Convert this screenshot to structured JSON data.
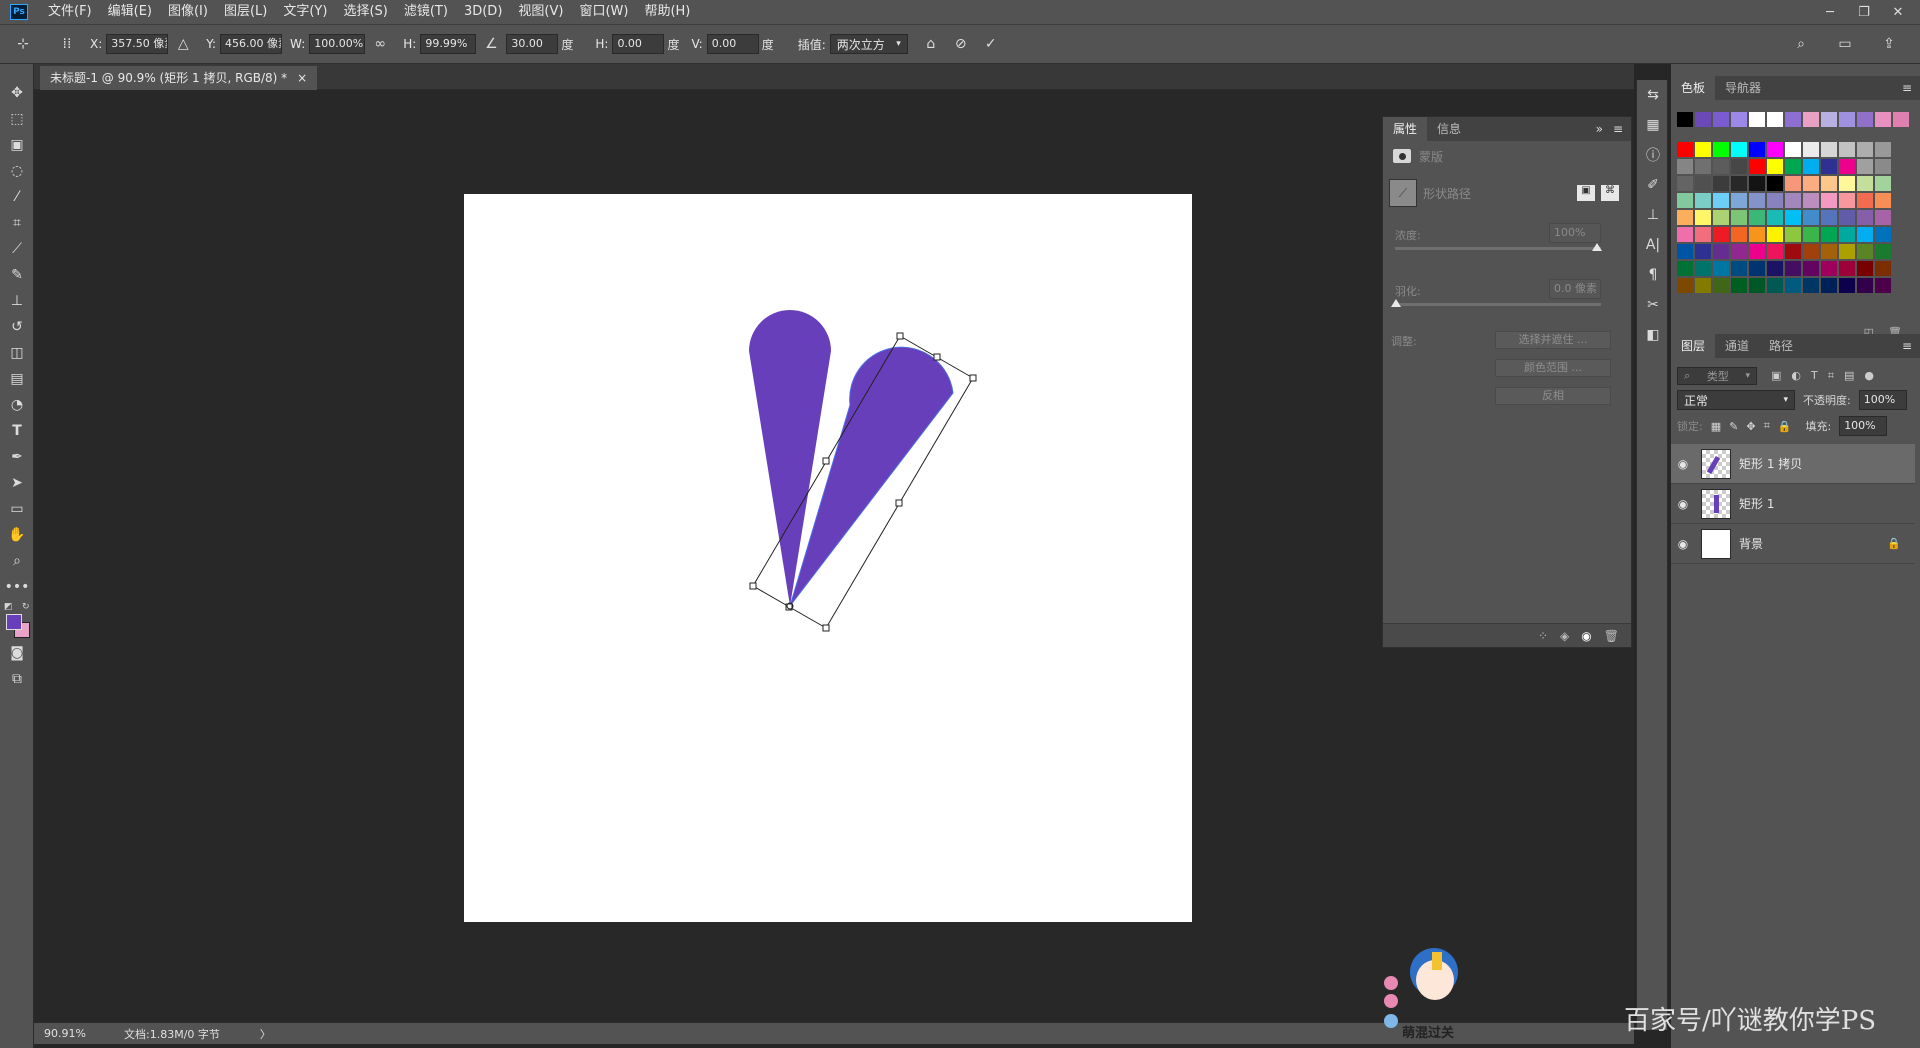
{
  "menu": {
    "logo": "Ps",
    "items": [
      "文件(F)",
      "编辑(E)",
      "图像(I)",
      "图层(L)",
      "文字(Y)",
      "选择(S)",
      "滤镜(T)",
      "3D(D)",
      "视图(V)",
      "窗口(W)",
      "帮助(H)"
    ],
    "window_buttons": [
      "─",
      "❐",
      "✕"
    ]
  },
  "options": {
    "x_label": "X:",
    "x_value": "357.50 像素",
    "y_label": "Y:",
    "y_value": "456.00 像素",
    "w_label": "W:",
    "w_value": "100.00%",
    "h_label": "H:",
    "h_value": "99.99%",
    "angle_value": "30.00",
    "angle_unit": "度",
    "hskew_label": "H:",
    "hskew_value": "0.00",
    "hskew_unit": "度",
    "vskew_label": "V:",
    "vskew_value": "0.00",
    "vskew_unit": "度",
    "interp_label": "插值:",
    "interp_value": "两次立方"
  },
  "document": {
    "tab_title": "未标题-1 @ 90.9% (矩形 1 拷贝, RGB/8) *",
    "tab_close": "×",
    "shape_color": "#673fbb"
  },
  "status": {
    "zoom": "90.91%",
    "doc_info": "文档:1.83M/0 字节",
    "arrow": "〉"
  },
  "properties": {
    "tabs": [
      "属性",
      "信息"
    ],
    "mask_label": "蒙版",
    "shape_path_label": "形状路径",
    "density_label": "浓度:",
    "density_value": "100%",
    "density_level": 1.0,
    "feather_label": "羽化:",
    "feather_value": "0.0 像素",
    "feather_level": 0.0,
    "adjust_label": "调整:",
    "buttons": [
      "选择并遮住 ...",
      "颜色范围 ...",
      "反相"
    ]
  },
  "swatches": {
    "tabs": [
      "色板",
      "导航器"
    ],
    "recent": [
      "#000000",
      "#6b4ab7",
      "#7a5bd0",
      "#9c88e6",
      "#ffffff",
      "#ffffff",
      "#8c6fd0",
      "#e8a0c4",
      "#b8b0e0",
      "#a090e0",
      "#9070c8",
      "#e890c0",
      "#e080b0"
    ],
    "grid": [
      [
        "#ff0000",
        "#ffff00",
        "#00ff00",
        "#00ffff",
        "#0000ff",
        "#ff00ff",
        "#ffffff",
        "#ebebeb",
        "#d6d6d6",
        "#c2c2c2",
        "#adadad",
        "#999999"
      ],
      [
        "#858585",
        "#707070",
        "#5c5c5c",
        "#474747",
        "#ff0000",
        "#ffff00",
        "#00a650",
        "#00aeef",
        "#2e3192",
        "#ec008c",
        "#a0a0a0",
        "#8a8a8a"
      ],
      [
        "#646464",
        "#505050",
        "#3c3c3c",
        "#282828",
        "#141414",
        "#000000",
        "#f7977a",
        "#f9ad81",
        "#fdc68a",
        "#fff79a",
        "#c4df9b",
        "#a3d39c"
      ],
      [
        "#82ca9d",
        "#7bcdc8",
        "#6ecff6",
        "#7ea7d8",
        "#8493ca",
        "#8882be",
        "#a187be",
        "#bc8dbf",
        "#f49ac2",
        "#f6989d",
        "#f26c4f",
        "#f68e55"
      ],
      [
        "#fbaf5d",
        "#fff568",
        "#acd372",
        "#7cc576",
        "#3bb878",
        "#1abbb4",
        "#00bff3",
        "#438ccb",
        "#5574b9",
        "#605ca8",
        "#855fa8",
        "#a763a8"
      ],
      [
        "#f06ea9",
        "#f26d7d",
        "#ed1c24",
        "#f26522",
        "#f7941d",
        "#fff200",
        "#8dc63f",
        "#39b54a",
        "#00a651",
        "#00a99d",
        "#00aeef",
        "#0072bc"
      ],
      [
        "#0054a6",
        "#2e3192",
        "#662d91",
        "#92278f",
        "#ec008c",
        "#ed145b",
        "#9e0b0f",
        "#a0410d",
        "#a36209",
        "#aba000",
        "#598527",
        "#1a7b30"
      ],
      [
        "#007236",
        "#00746b",
        "#0076a3",
        "#004b80",
        "#003471",
        "#1b1464",
        "#440e62",
        "#630460",
        "#9e005d",
        "#9e0039",
        "#790000",
        "#7b2e00"
      ],
      [
        "#7d4900",
        "#827b00",
        "#406618",
        "#005e20",
        "#005826",
        "#005952",
        "#005b7f",
        "#003663",
        "#002157",
        "#0d004c",
        "#32004b",
        "#4b0049"
      ]
    ]
  },
  "layers": {
    "tabs": [
      "图层",
      "通道",
      "路径"
    ],
    "filter_placeholder": "类型",
    "blend_mode": "正常",
    "opacity_label": "不透明度:",
    "opacity_value": "100%",
    "lock_label": "锁定:",
    "fill_label": "填充:",
    "fill_value": "100%",
    "items": [
      {
        "name": "矩形 1 拷贝",
        "selected": true
      },
      {
        "name": "矩形 1",
        "selected": false
      },
      {
        "name": "背景",
        "selected": false
      }
    ]
  },
  "watermark": {
    "mascot_text": "萌混过关",
    "text": "百家号/吖谜教你学PS"
  }
}
